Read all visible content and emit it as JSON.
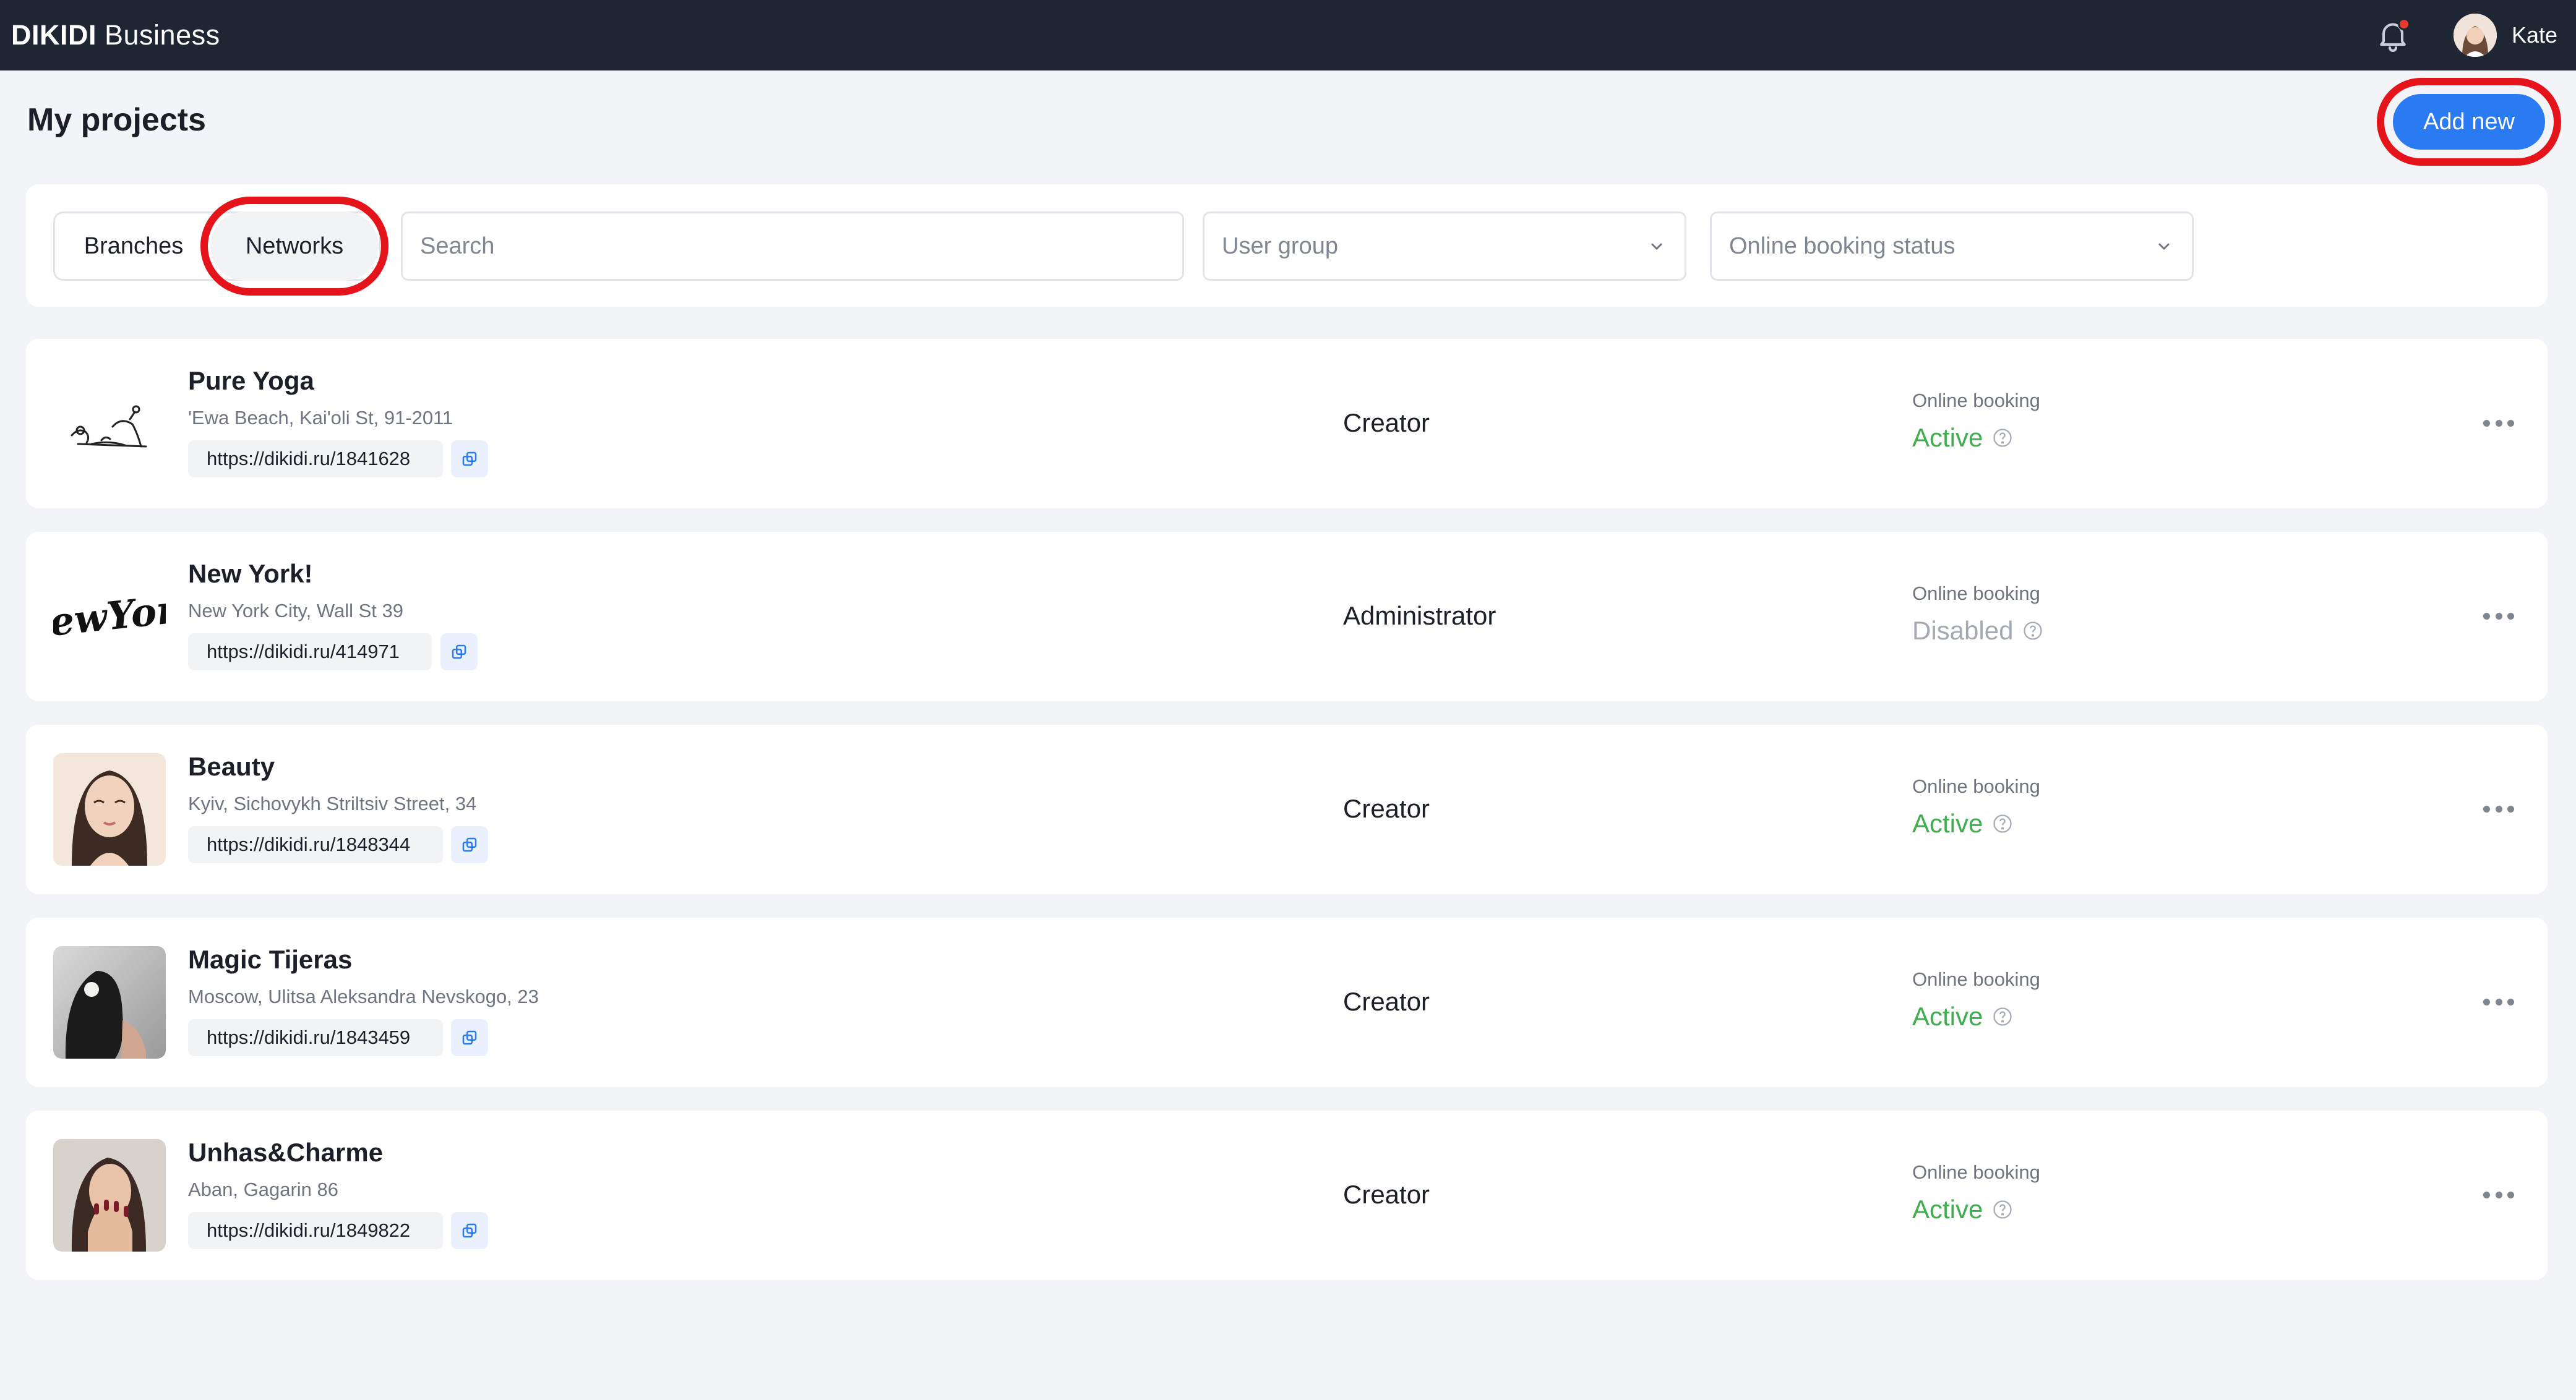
{
  "header": {
    "brand_bold": "DIKIDI",
    "brand_rest": " Business",
    "bell_icon": "bell-icon",
    "notification_dot_color": "#e8392f",
    "user_name": "Kate"
  },
  "page": {
    "title": "My projects",
    "add_button": "Add new"
  },
  "filters": {
    "tabs": [
      "Branches",
      "Networks"
    ],
    "active_tab": "Networks",
    "search_placeholder": "Search",
    "user_group_placeholder": "User group",
    "booking_status_placeholder": "Online booking status"
  },
  "colors": {
    "accent": "#2a7af1",
    "highlight": "#e5141b",
    "active": "#3fae4f",
    "disabled": "#a4a9b3",
    "topbar": "#1e2533"
  },
  "projects": [
    {
      "name": "Pure Yoga",
      "address": "'Ewa Beach, Kai'oli St, 91-2011",
      "link": "https://dikidi.ru/1841628",
      "role": "Creator",
      "booking_label": "Online booking",
      "booking_status": "Active",
      "logo": "yoga-sketch-logo"
    },
    {
      "name": "New York!",
      "address": "New York City, Wall St 39",
      "link": "https://dikidi.ru/414971",
      "role": "Administrator",
      "booking_label": "Online booking",
      "booking_status": "Disabled",
      "logo": "newyork-script-logo"
    },
    {
      "name": "Beauty",
      "address": "Kyiv, Sichovykh Striltsiv Street, 34",
      "link": "https://dikidi.ru/1848344",
      "role": "Creator",
      "booking_label": "Online booking",
      "booking_status": "Active",
      "logo": "woman-portrait-logo"
    },
    {
      "name": "Magic Tijeras",
      "address": "Moscow, Ulitsa Aleksandra Nevskogo, 23",
      "link": "https://dikidi.ru/1843459",
      "role": "Creator",
      "booking_label": "Online booking",
      "booking_status": "Active",
      "logo": "hair-photo-logo"
    },
    {
      "name": "Unhas&Charme",
      "address": "Aban, Gagarin 86",
      "link": "https://dikidi.ru/1849822",
      "role": "Creator",
      "booking_label": "Online booking",
      "booking_status": "Active",
      "logo": "nails-photo-logo"
    }
  ]
}
